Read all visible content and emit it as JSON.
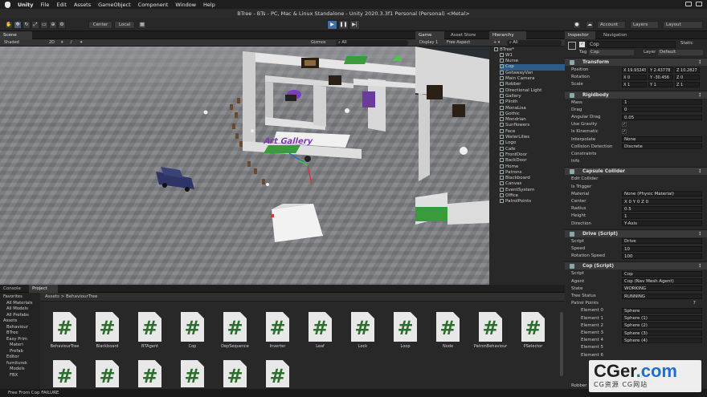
{
  "menu": {
    "app": "Unity",
    "items": [
      "File",
      "Edit",
      "Assets",
      "GameObject",
      "Component",
      "Window",
      "Help"
    ]
  },
  "window": {
    "title": "BTree - BTs - PC, Mac & Linux Standalone - Unity 2020.3.3f1 Personal (Personal) <Metal>"
  },
  "toolbar": {
    "pivot": "Center",
    "space": "Local",
    "account": "Account",
    "layers": "Layers",
    "layout": "Layout"
  },
  "scene": {
    "tab": "Scene",
    "shading": "Shaded",
    "mode2d": "2D",
    "gizmos": "Gizmos",
    "search": "All"
  },
  "game": {
    "tab": "Game",
    "tab2": "Asset Store",
    "display": "Display 1",
    "aspect": "Free Aspect"
  },
  "hierarchy": {
    "tab": "Hierarchy",
    "search": "All",
    "root": "BTree*",
    "items": [
      "W1",
      "Nurse",
      "Cop",
      "GetawayVan",
      "Main Camera",
      "Robber",
      "Directional Light",
      "Gallery",
      "Plinth",
      "MonaLisa",
      "Gothic",
      "Mondrian",
      "Sunflowers",
      "Face",
      "WaterLilies",
      "Logo",
      "Cafe",
      "FrontDoor",
      "BackDoor",
      "Home",
      "Patrons",
      "Blackboard",
      "Canvas",
      "EventSystem",
      "Office",
      "PatrolPoints"
    ]
  },
  "inspector": {
    "tab": "Inspector",
    "tab2": "Navigation",
    "name": "Cop",
    "static": "Static",
    "tag_label": "Tag",
    "tag": "Cop",
    "layer_label": "Layer",
    "layer": "Default",
    "transform": {
      "title": "Transform",
      "rows": [
        {
          "label": "Position",
          "x": "19.93245",
          "y": "2.43778",
          "z": "10.2827"
        },
        {
          "label": "Rotation",
          "x": "0",
          "y": "-30.456",
          "z": "0"
        },
        {
          "label": "Scale",
          "x": "1",
          "y": "1",
          "z": "1"
        }
      ]
    },
    "rigidbody": {
      "title": "Rigidbody",
      "rows": [
        {
          "label": "Mass",
          "value": "1"
        },
        {
          "label": "Drag",
          "value": "0"
        },
        {
          "label": "Angular Drag",
          "value": "0.05"
        },
        {
          "label": "Use Gravity",
          "value": "✓"
        },
        {
          "label": "Is Kinematic",
          "value": "✓"
        },
        {
          "label": "Interpolate",
          "value": "None"
        },
        {
          "label": "Collision Detection",
          "value": "Discrete"
        },
        {
          "label": "Constraints",
          "value": ""
        },
        {
          "label": "Info",
          "value": ""
        }
      ]
    },
    "capsule": {
      "title": "Capsule Collider",
      "rows": [
        {
          "label": "Edit Collider",
          "value": ""
        },
        {
          "label": "Is Trigger",
          "value": ""
        },
        {
          "label": "Material",
          "value": "None (Physic Material)"
        },
        {
          "label": "Center",
          "value": "X 0    Y 0    Z 0"
        },
        {
          "label": "Radius",
          "value": "0.5"
        },
        {
          "label": "Height",
          "value": "1"
        },
        {
          "label": "Direction",
          "value": "Y-Axis"
        }
      ]
    },
    "drive": {
      "title": "Drive (Script)",
      "rows": [
        {
          "label": "Script",
          "value": "Drive"
        },
        {
          "label": "Speed",
          "value": "10"
        },
        {
          "label": "Rotation Speed",
          "value": "100"
        }
      ]
    },
    "cop": {
      "title": "Cop (Script)",
      "rows": [
        {
          "label": "Script",
          "value": "Cop"
        },
        {
          "label": "Agent",
          "value": "Cop (Nav Mesh Agent)"
        },
        {
          "label": "State",
          "value": "WORKING"
        },
        {
          "label": "Tree Status",
          "value": "RUNNING"
        }
      ]
    },
    "patrol": {
      "title": "Patrol Points",
      "count": "7",
      "rows": [
        {
          "label": "Element 0",
          "value": "Sphere"
        },
        {
          "label": "Element 1",
          "value": "Sphere (1)"
        },
        {
          "label": "Element 2",
          "value": "Sphere (2)"
        },
        {
          "label": "Element 3",
          "value": "Sphere (3)"
        },
        {
          "label": "Element 4",
          "value": "Sphere (4)"
        },
        {
          "label": "Element 5",
          "value": ""
        },
        {
          "label": "Element 6",
          "value": ""
        }
      ]
    },
    "bottom": "Robber"
  },
  "project": {
    "tab1": "Console",
    "tab2": "Project",
    "breadcrumb": [
      "Assets",
      "BehaviourTree"
    ],
    "tree": [
      "Favorites",
      "All Materials",
      "All Models",
      "All Prefabs",
      "Assets",
      "Behaviour",
      "BTree",
      "Easy Prim",
      "Materi",
      "Prefab",
      "Editor",
      "furniturek",
      "Models",
      "FBX"
    ],
    "assets": [
      "BehaviourTree",
      "Blackboard",
      "BTAgent",
      "Cop",
      "DepSequence",
      "Inverter",
      "Leaf",
      "Lock",
      "Loop",
      "Node",
      "PatronBehaviour",
      "PSelector",
      "",
      "",
      "",
      "",
      "",
      ""
    ]
  },
  "status": "Free From Cop FAILURE",
  "watermark": {
    "big": "CGer.com",
    "small": "CG资源 CG网站"
  }
}
